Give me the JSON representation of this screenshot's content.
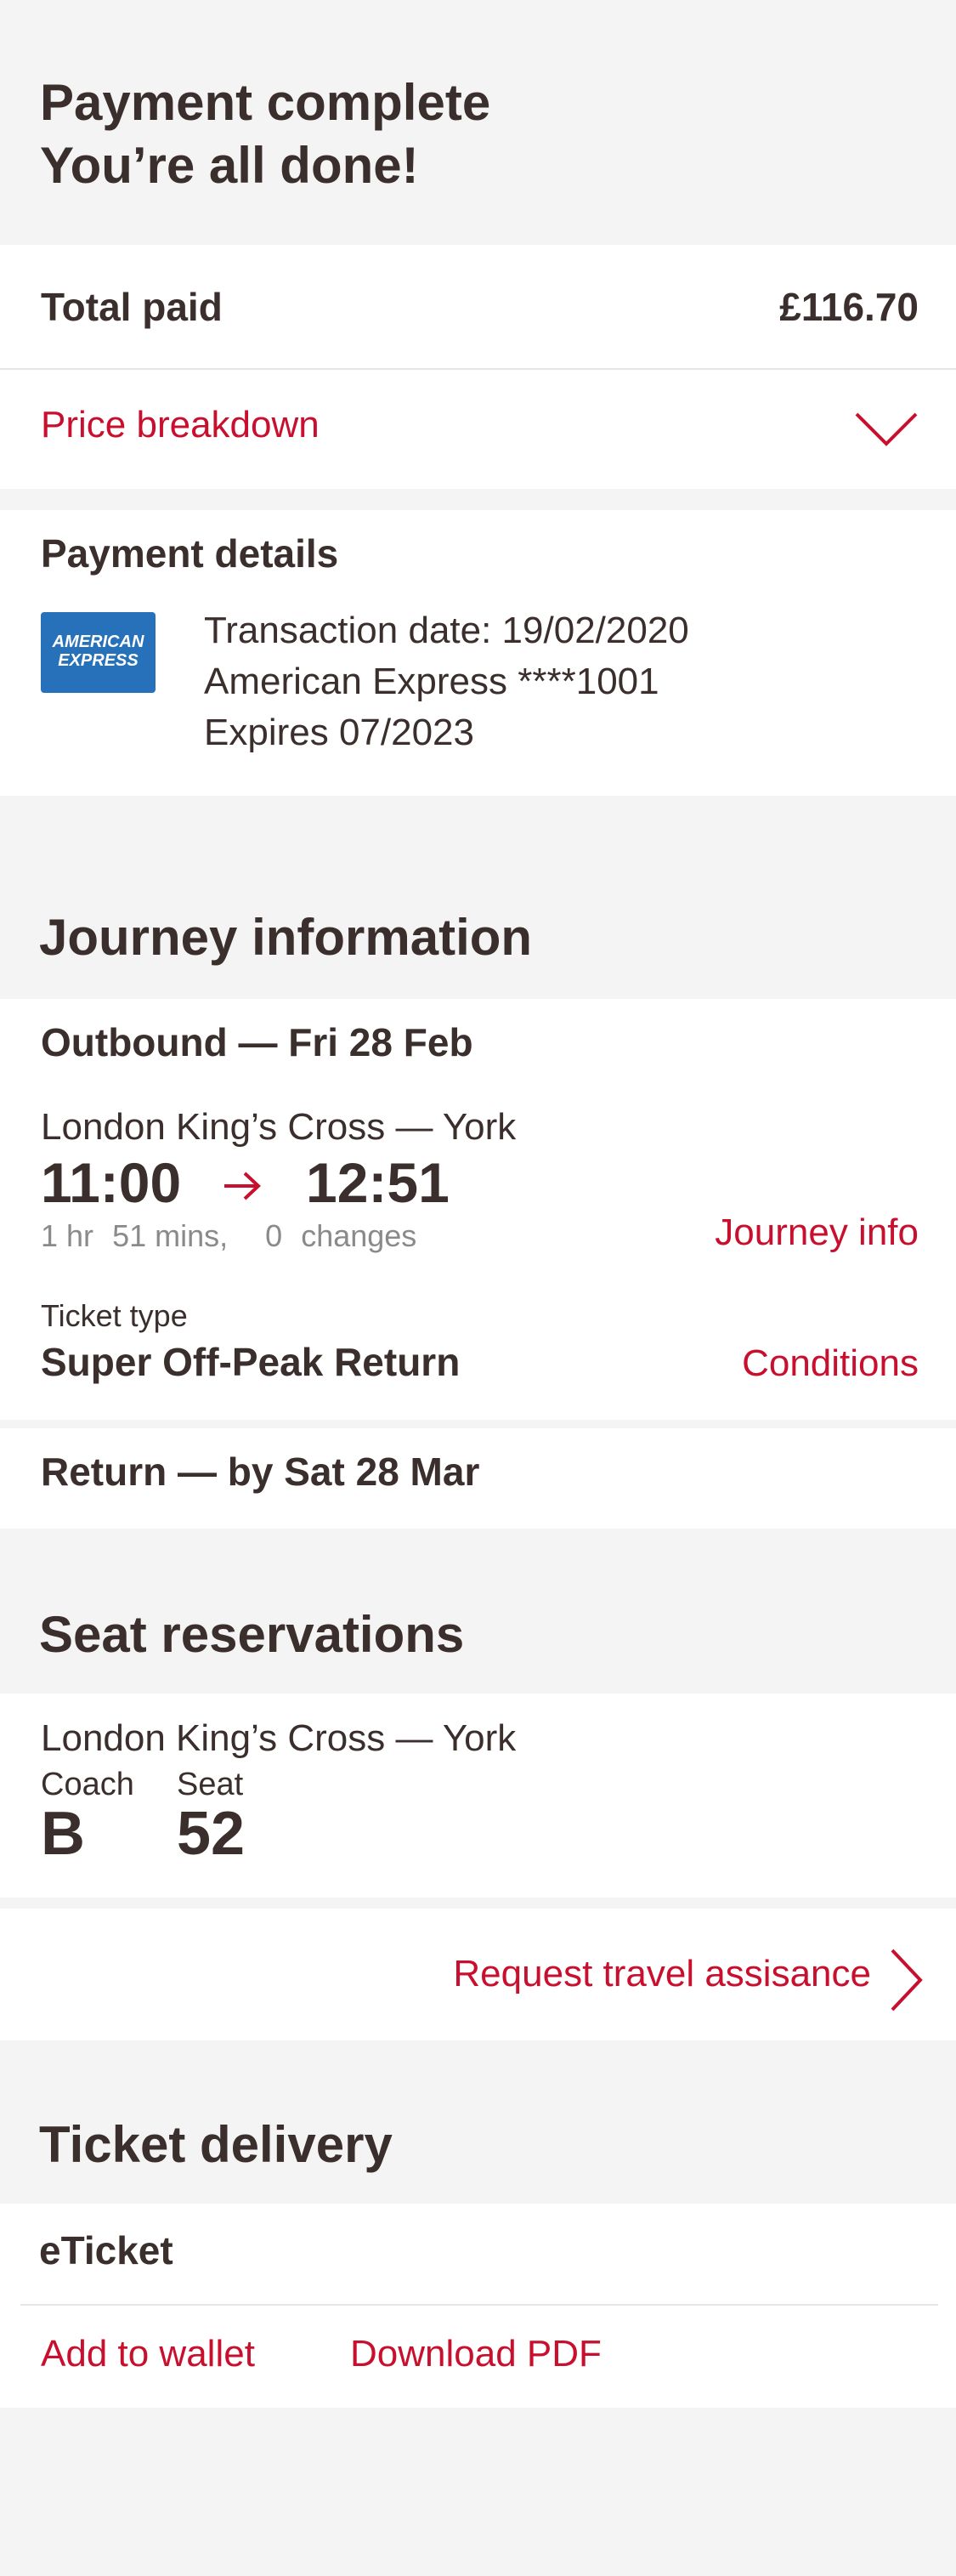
{
  "header": {
    "line1": "Payment complete",
    "line2": "You’re all done!"
  },
  "total": {
    "label": "Total paid",
    "amount": "£116.70"
  },
  "price_breakdown": {
    "label": "Price breakdown"
  },
  "payment": {
    "title": "Payment details",
    "card_logo_line1": "AMERICAN",
    "card_logo_line2": "EXPRESS",
    "transaction_date": "Transaction date: 19/02/2020",
    "card": "American Express ****1001",
    "expires": "Expires 07/2023"
  },
  "journey": {
    "section_title": "Journey information",
    "outbound_title": "Outbound — Fri 28 Feb",
    "route": "London King’s Cross — York",
    "depart": "11:00",
    "arrive": "12:51",
    "duration_hr": "1 hr",
    "duration_mins": "51 mins,",
    "changes_count": "0",
    "changes_label": "changes",
    "journey_info_link": "Journey info",
    "ticket_type_label": "Ticket type",
    "ticket_type": "Super Off-Peak Return",
    "conditions_link": "Conditions",
    "return_title": "Return — by Sat 28 Mar"
  },
  "seats": {
    "section_title": "Seat reservations",
    "route": "London King’s Cross — York",
    "coach_label": "Coach",
    "coach_value": "B",
    "seat_label": "Seat",
    "seat_value": "52"
  },
  "assistance": {
    "label": "Request travel assisance"
  },
  "delivery": {
    "section_title": "Ticket delivery",
    "type": "eTicket",
    "add_wallet": "Add to wallet",
    "download_pdf": "Download PDF"
  },
  "colors": {
    "accent": "#c8102e",
    "text": "#3a2f2c",
    "background": "#f4f4f4",
    "amex_blue": "#2671b9"
  }
}
